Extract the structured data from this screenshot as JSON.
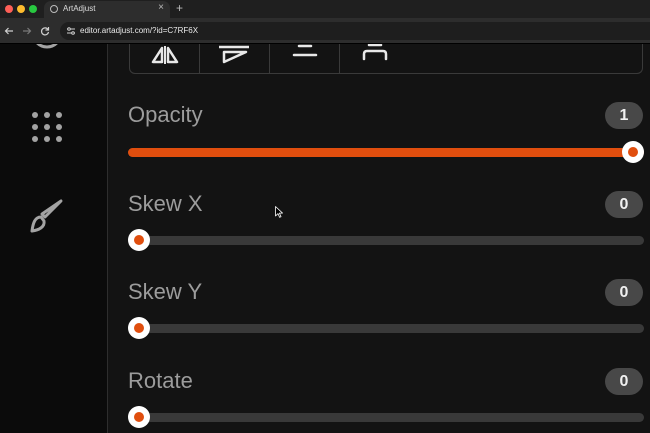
{
  "browser": {
    "tab_title": "ArtAdjust",
    "tab_close": "×",
    "new_tab": "+",
    "url": "editor.artadjust.com/?id=C7RF6X",
    "traffic_colors": [
      "#fe5f57",
      "#febc2e",
      "#28c840"
    ]
  },
  "sidebar": {
    "icons": [
      "target-icon",
      "apps-grid-icon",
      "brush-icon"
    ]
  },
  "tools": [
    "flip-horizontal-icon",
    "align-slant-icon",
    "align-center-icon",
    "align-top-icon"
  ],
  "sliders": [
    {
      "label": "Opacity",
      "value": "1",
      "fraction": 1.0
    },
    {
      "label": "Skew X",
      "value": "0",
      "fraction": 0.0
    },
    {
      "label": "Skew Y",
      "value": "0",
      "fraction": 0.0
    },
    {
      "label": "Rotate",
      "value": "0",
      "fraction": 0.0
    }
  ],
  "colors": {
    "accent": "#e04e0e",
    "track": "#393939",
    "badge": "#484848"
  }
}
